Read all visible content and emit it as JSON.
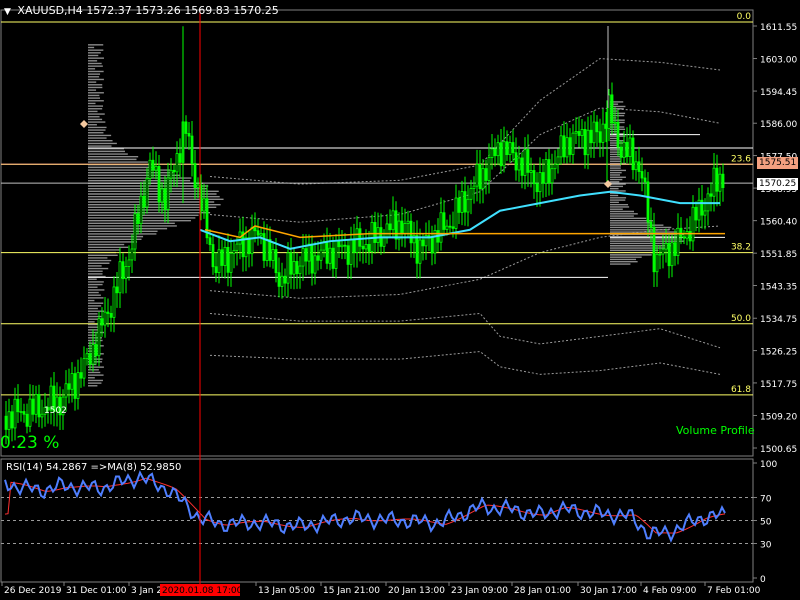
{
  "header": {
    "symbol": "XAUUSD,H4",
    "open": "1572.37",
    "high": "1573.26",
    "low": "1569.83",
    "close": "1570.25"
  },
  "change_text": "0.23 %",
  "partial_label": "1502",
  "volume_profile_label": "Volume Profile",
  "rsi_header": {
    "label": "RSI(14) 54.2867",
    "ma_label": "=>MA(8) 52.9850"
  },
  "price_tags": {
    "bid": "1570.25",
    "line": "1575.51"
  },
  "fib_levels": [
    {
      "label": "0.0",
      "price": 1612.6
    },
    {
      "label": "23.6",
      "price": 1575.2
    },
    {
      "label": "38.2",
      "price": 1552.0
    },
    {
      "label": "50.0",
      "price": 1533.3
    },
    {
      "label": "61.8",
      "price": 1514.6
    }
  ],
  "chart_data": {
    "type": "candlestick",
    "y_ticks": [
      "1611.55",
      "1603.00",
      "1594.45",
      "1586.00",
      "1577.50",
      "1568.95",
      "1560.40",
      "1551.85",
      "1543.35",
      "1534.75",
      "1526.25",
      "1517.75",
      "1509.20",
      "1500.65"
    ],
    "ylim": [
      1500.65,
      1611.55
    ],
    "rsi_ticks": [
      "100",
      "70",
      "50",
      "30",
      "0"
    ],
    "rsi_levels": [
      70,
      50,
      30
    ],
    "x_ticks": [
      "26 Dec 2019",
      "31 Dec 01:00",
      "3 Jan 2",
      "13 Jan 05:00",
      "15 Jan 21:00",
      "20 Jan 13:00",
      "23 Jan 09:00",
      "28 Jan 01:00",
      "30 Jan 17:00",
      "4 Feb 09:00",
      "7 Feb 01:00"
    ],
    "cursor_label": "2020.01.08 17:00",
    "colors": {
      "bull": "#00ff00",
      "fib": "#ffff66",
      "ma_cyan": "#40e0ff",
      "poc_orange": "#ffa500",
      "rsi_blue": "#4f7fff",
      "rsi_ma_red": "#ff3030",
      "cursor_red": "#ff0000",
      "tag_salmon": "#f4a080",
      "tag_white": "#ffffff"
    }
  }
}
